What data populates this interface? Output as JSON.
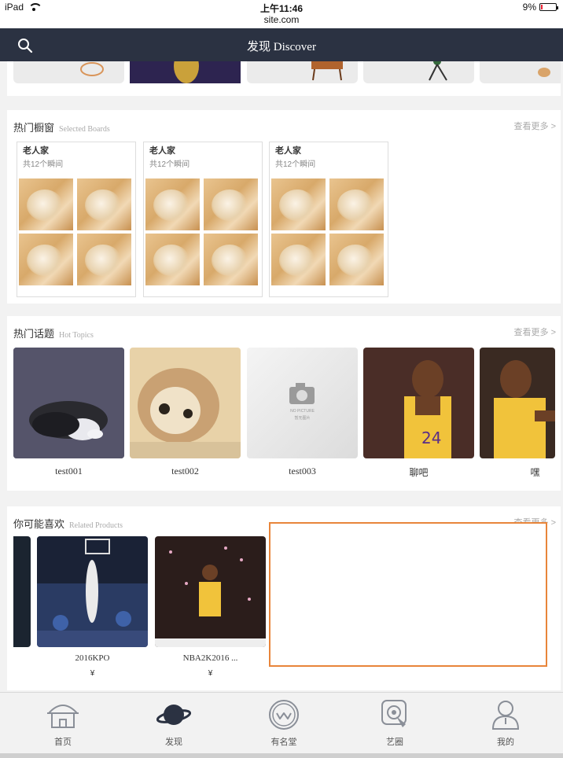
{
  "status_bar": {
    "device": "iPad",
    "time": "上午11:46",
    "url": "site.com",
    "battery": "9%"
  },
  "nav": {
    "title": "发现 Discover",
    "search_icon": "search-icon"
  },
  "boards_section": {
    "title": "热门橱窗",
    "title_en": "Selected Boards",
    "more": "查看更多 >",
    "boards": [
      {
        "title": "老人家",
        "subtitle": "共12个瞬间"
      },
      {
        "title": "老人家",
        "subtitle": "共12个瞬间"
      },
      {
        "title": "老人家",
        "subtitle": "共12个瞬间"
      }
    ]
  },
  "topics_section": {
    "title": "热门话题",
    "title_en": "Hot Topics",
    "more": "查看更多 >",
    "topics": [
      {
        "label": "test001"
      },
      {
        "label": "test002"
      },
      {
        "label": "test003"
      },
      {
        "label": "聊吧"
      },
      {
        "label": "嘿"
      }
    ],
    "no_picture_text": "NO PICTURE",
    "no_picture_cn": "暂无图片"
  },
  "related_section": {
    "title": "你可能喜欢",
    "title_en": "Related Products",
    "more": "查看更多 >",
    "products": [
      {
        "name": "2016KPO",
        "price": "¥"
      },
      {
        "name": "NBA2K2016 ...",
        "price": "¥"
      }
    ]
  },
  "tabbar": {
    "items": [
      {
        "label": "首页",
        "icon": "home-icon"
      },
      {
        "label": "发现",
        "icon": "planet-icon"
      },
      {
        "label": "有名堂",
        "icon": "circle-w-icon"
      },
      {
        "label": "艺圈",
        "icon": "touch-icon"
      },
      {
        "label": "我的",
        "icon": "user-icon"
      }
    ]
  },
  "colors": {
    "navbar": "#2b3242",
    "highlight": "#e8853a",
    "page_bg": "#f2f2f2"
  }
}
